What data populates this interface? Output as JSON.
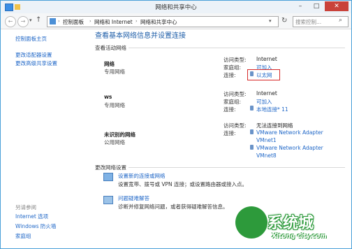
{
  "window": {
    "title": "网络和共享中心"
  },
  "address": {
    "segments": [
      "控制面板",
      "网络和 Internet",
      "网络和共享中心"
    ],
    "search_placeholder": "搜索控制..."
  },
  "sidebar": {
    "items": [
      "控制面板主页",
      "更改适配器设置",
      "更改高级共享设置"
    ],
    "see_also_title": "另请参阅",
    "see_also": [
      "Internet 选项",
      "Windows 防火墙",
      "家庭组"
    ]
  },
  "main": {
    "heading": "查看基本网络信息并设置连接",
    "active_section": "查看活动网络",
    "networks": [
      {
        "name": "网络",
        "type": "专用网络",
        "rows": [
          {
            "label": "访问类型:",
            "value": "Internet"
          },
          {
            "label": "家庭组:",
            "value": "可加入"
          },
          {
            "label": "连接:",
            "value": "以太网"
          }
        ]
      },
      {
        "name": "ws",
        "type": "专用网络",
        "rows": [
          {
            "label": "访问类型:",
            "value": "Internet"
          },
          {
            "label": "家庭组:",
            "value": "可加入"
          },
          {
            "label": "连接:",
            "value": "本地连接* 11"
          }
        ]
      },
      {
        "name": "未识别的网络",
        "type": "公用网络",
        "rows": [
          {
            "label": "访问类型:",
            "value": "无法连接到网络"
          },
          {
            "label": "连接:",
            "value": "VMware Network Adapter"
          }
        ],
        "extra": [
          "VMnet1",
          "VMware Network Adapter",
          "VMnet8"
        ]
      }
    ],
    "change_section": "更改网络设置",
    "tasks": [
      {
        "title": "设置新的连接或网络",
        "desc": "设置宽带、拨号或 VPN 连接；或设置路由器或接入点。"
      },
      {
        "title": "问题疑难解答",
        "desc": "诊断并修复网络问题，或者获得疑难解答信息。"
      }
    ]
  },
  "watermark": {
    "text": "系统城",
    "url": "Xitong city.com"
  },
  "colors": {
    "link": "#1e66c7",
    "heading": "#1e5ea8",
    "highlight": "#d62828"
  }
}
